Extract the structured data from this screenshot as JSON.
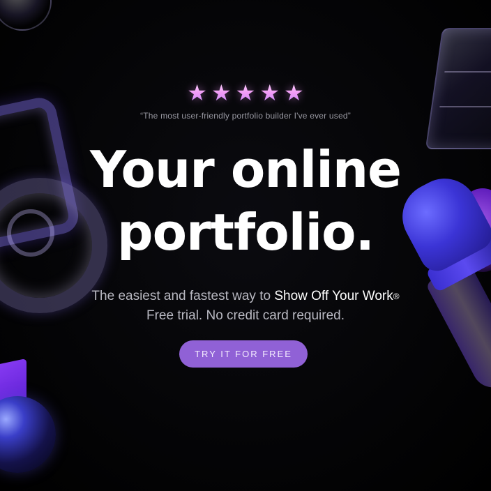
{
  "hero": {
    "rating": {
      "value": 5,
      "max": 5,
      "star_glyph": "★",
      "icon": "star-icon",
      "color": "#f19bf6"
    },
    "testimonial": "“The most user-friendly portfolio builder I've ever used”",
    "headline_line1": "Your online",
    "headline_line2": "portfolio.",
    "subline_prefix": "The easiest and fastest way to ",
    "subline_highlight": "Show Off Your Work",
    "subline_mark": "®",
    "subline_second": "Free trial. No credit card required.",
    "cta_label": "TRY IT FOR FREE"
  },
  "colors": {
    "background": "#000000",
    "cta_background": "#9061d6",
    "headline": "#ffffff",
    "subtext": "#b9b9c2",
    "accent_purple": "#6a20d0",
    "accent_blue": "#3b34d6"
  }
}
